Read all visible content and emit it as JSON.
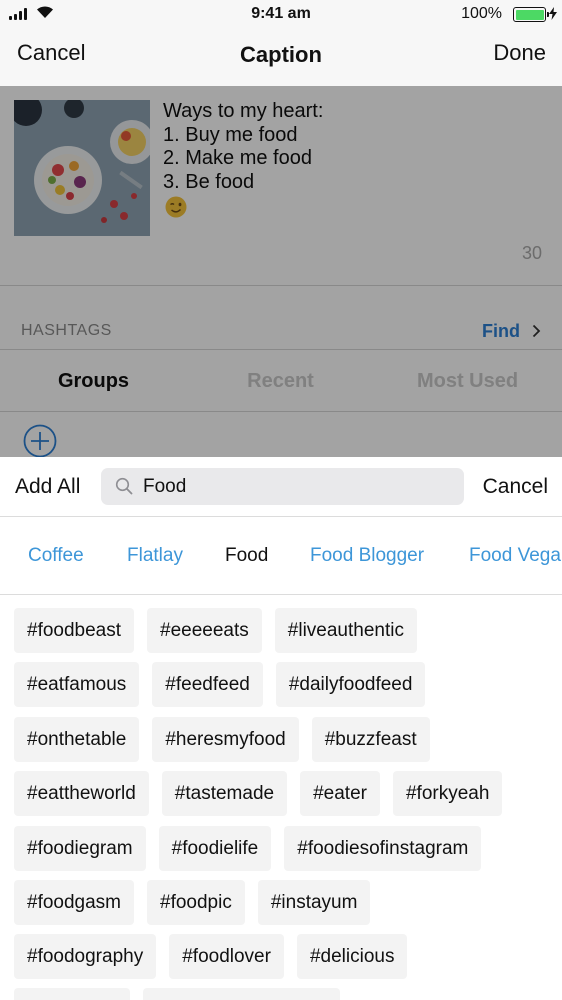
{
  "status_bar": {
    "time": "9:41 am",
    "battery": "100%"
  },
  "nav": {
    "cancel": "Cancel",
    "title": "Caption",
    "done": "Done"
  },
  "caption": {
    "text": "Ways to my heart:\n1. Buy me food\n2. Make me food\n3. Be food",
    "emoji_icon": "winking-face-icon",
    "char_count": "30"
  },
  "hashtags_section": {
    "label": "HASHTAGS",
    "find": "Find"
  },
  "tabs": [
    {
      "label": "Groups",
      "active": true
    },
    {
      "label": "Recent",
      "active": false
    },
    {
      "label": "Most Used",
      "active": false
    }
  ],
  "search": {
    "add_all": "Add All",
    "value": "Food",
    "cancel": "Cancel"
  },
  "groups": [
    "Coffee",
    "Flatlay",
    "Food",
    "Food Blogger",
    "Food Vega"
  ],
  "selected_group": "Food",
  "tag_rows": [
    [
      "#foodbeast",
      "#eeeeeats",
      "#liveauthentic"
    ],
    [
      "#eatfamous",
      "#feedfeed",
      "#dailyfoodfeed"
    ],
    [
      "#onthetable",
      "#heresmyfood",
      "#buzzfeast"
    ],
    [
      "#eattheworld",
      "#tastemade",
      "#eater",
      "#forkyeah"
    ],
    [
      "#foodiegram",
      "#foodielife",
      "#foodiesofinstagram"
    ],
    [
      "#foodgasm",
      "#foodpic",
      "#instayum"
    ],
    [
      "#foodography",
      "#foodlover",
      "#delicious"
    ]
  ],
  "colors": {
    "accent": "#3d96d8",
    "find": "#2d7fd3",
    "battery": "#4cd964"
  }
}
